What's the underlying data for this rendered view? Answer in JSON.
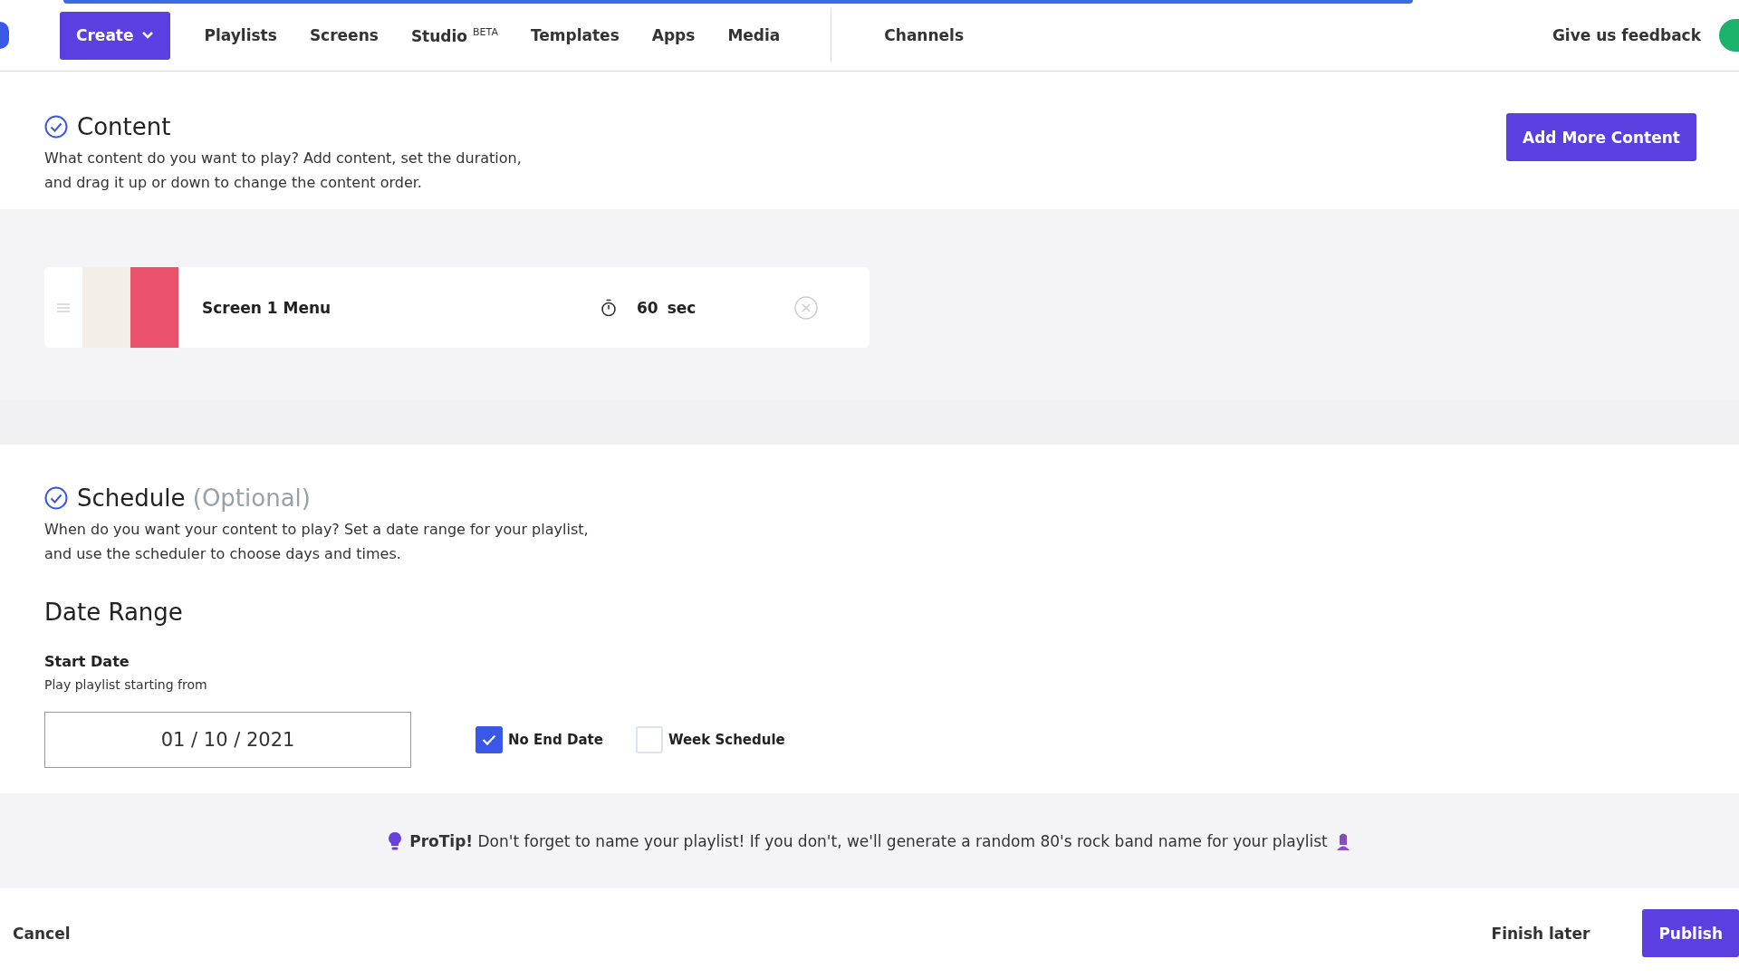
{
  "nav": {
    "create": "Create",
    "items": [
      {
        "label": "Playlists"
      },
      {
        "label": "Screens"
      },
      {
        "label": "Studio",
        "sup": "BETA"
      },
      {
        "label": "Templates"
      },
      {
        "label": "Apps"
      },
      {
        "label": "Media"
      }
    ],
    "channels": "Channels",
    "feedback": "Give us feedback"
  },
  "content": {
    "title": "Content",
    "description": "What content do you want to play? Add content, set the duration, and drag it up or down to change the content order.",
    "add_button": "Add More Content",
    "items": [
      {
        "name": "Screen 1 Menu",
        "duration": "60",
        "unit": "sec"
      }
    ]
  },
  "schedule": {
    "title": "Schedule",
    "optional": "(Optional)",
    "description": "When do you want your content to play? Set a date range for your playlist, and use the scheduler to choose days and times.",
    "date_range": "Date Range",
    "start_label": "Start Date",
    "start_hint": "Play playlist starting from",
    "start_value": "01 / 10 / 2021",
    "options": [
      {
        "label": "No End Date",
        "checked": true
      },
      {
        "label": "Week Schedule",
        "checked": false
      }
    ]
  },
  "protip": "**ProTip!** Don't forget to name your playlist! If you don't, we'll generate a random 80's rock band name for your playlist",
  "footer": {
    "cancel": "Cancel",
    "finish_later": "Finish later",
    "publish": "Publish"
  }
}
